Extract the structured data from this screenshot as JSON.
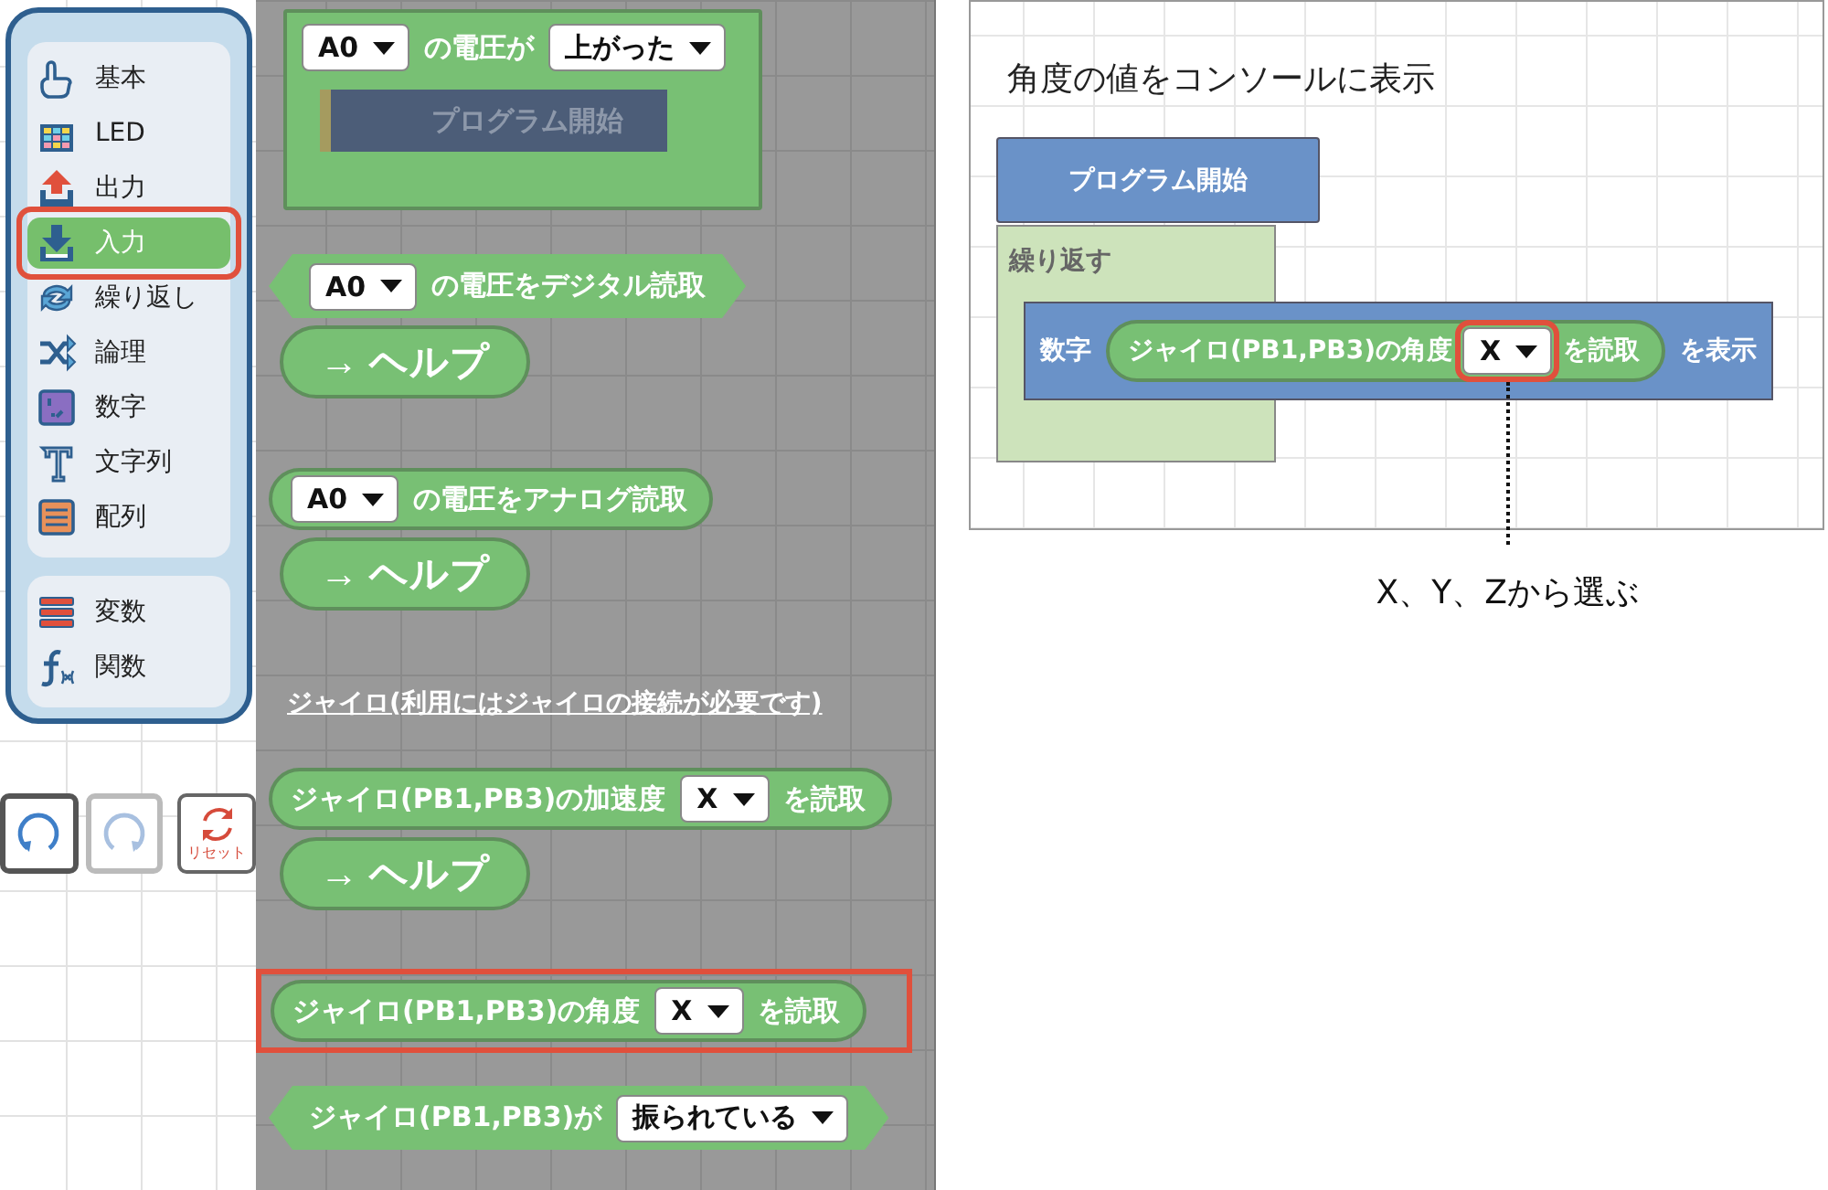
{
  "sidebar": {
    "groups": [
      {
        "items": [
          {
            "kind": "hand",
            "label": "基本",
            "selected": false,
            "highlighted": false
          },
          {
            "kind": "led",
            "label": "LED",
            "selected": false,
            "highlighted": false
          },
          {
            "kind": "output",
            "label": "出力",
            "selected": false,
            "highlighted": false
          },
          {
            "kind": "input",
            "label": "入力",
            "selected": true,
            "highlighted": true
          },
          {
            "kind": "loop",
            "label": "繰り返し",
            "selected": false,
            "highlighted": false
          },
          {
            "kind": "logic",
            "label": "論理",
            "selected": false,
            "highlighted": false
          },
          {
            "kind": "number",
            "label": "数字",
            "selected": false,
            "highlighted": false
          },
          {
            "kind": "text",
            "label": "文字列",
            "selected": false,
            "highlighted": false
          },
          {
            "kind": "list",
            "label": "配列",
            "selected": false,
            "highlighted": false
          }
        ]
      },
      {
        "items": [
          {
            "kind": "variable",
            "label": "変数",
            "selected": false,
            "highlighted": false
          },
          {
            "kind": "function",
            "label": "関数",
            "selected": false,
            "highlighted": false
          }
        ]
      }
    ]
  },
  "toolbar": [
    {
      "kind": "undo",
      "disabled": false
    },
    {
      "kind": "redo",
      "disabled": true
    },
    {
      "kind": "reset",
      "label": "リセット",
      "disabled": false
    }
  ],
  "flyout": [
    {
      "kind": "event",
      "parts": [
        {
          "kind": "dropdown",
          "value": "A0"
        },
        {
          "kind": "text",
          "text": "の電圧が"
        },
        {
          "kind": "dropdown",
          "value": "上がった"
        }
      ],
      "inner": "プログラム開始",
      "highlighted": false
    },
    {
      "kind": "boolean",
      "parts": [
        {
          "kind": "dropdown",
          "value": "A0"
        },
        {
          "kind": "text",
          "text": "の電圧をデジタル読取"
        }
      ],
      "highlighted": false
    },
    {
      "kind": "help",
      "label": "→ ヘルプ",
      "highlighted": false
    },
    {
      "kind": "reporter",
      "parts": [
        {
          "kind": "dropdown",
          "value": "A0"
        },
        {
          "kind": "text",
          "text": "の電圧をアナログ読取"
        }
      ],
      "highlighted": false
    },
    {
      "kind": "help",
      "label": "→ ヘルプ",
      "highlighted": false
    },
    {
      "kind": "heading",
      "label": "ジャイロ(利用にはジャイロの接続が必要です)",
      "highlighted": false
    },
    {
      "kind": "reporter",
      "parts": [
        {
          "kind": "text",
          "text": "ジャイロ(PB1,PB3)の加速度"
        },
        {
          "kind": "dropdown",
          "value": "X"
        },
        {
          "kind": "text",
          "text": "を読取"
        }
      ],
      "highlighted": false
    },
    {
      "kind": "help",
      "label": "→ ヘルプ",
      "highlighted": false
    },
    {
      "kind": "reporter",
      "parts": [
        {
          "kind": "text",
          "text": "ジャイロ(PB1,PB3)の角度"
        },
        {
          "kind": "dropdown",
          "value": "X"
        },
        {
          "kind": "text",
          "text": "を読取"
        }
      ],
      "highlighted": true
    },
    {
      "kind": "boolean",
      "parts": [
        {
          "kind": "text",
          "text": "ジャイロ(PB1,PB3)が"
        },
        {
          "kind": "dropdown",
          "value": "振られている"
        }
      ],
      "highlighted": false
    }
  ],
  "example": {
    "title": "角度の値をコンソールに表示",
    "start_block": "プログラム開始",
    "loop_block": "繰り返す",
    "print_block": {
      "prefix": "数字",
      "reporter": [
        {
          "kind": "text",
          "text": "ジャイロ(PB1,PB3)の角度"
        },
        {
          "kind": "dropdown",
          "value": "X",
          "highlighted": true
        },
        {
          "kind": "text",
          "text": "を読取"
        }
      ],
      "suffix": "を表示"
    },
    "note": "X、Y、Zから選ぶ"
  }
}
